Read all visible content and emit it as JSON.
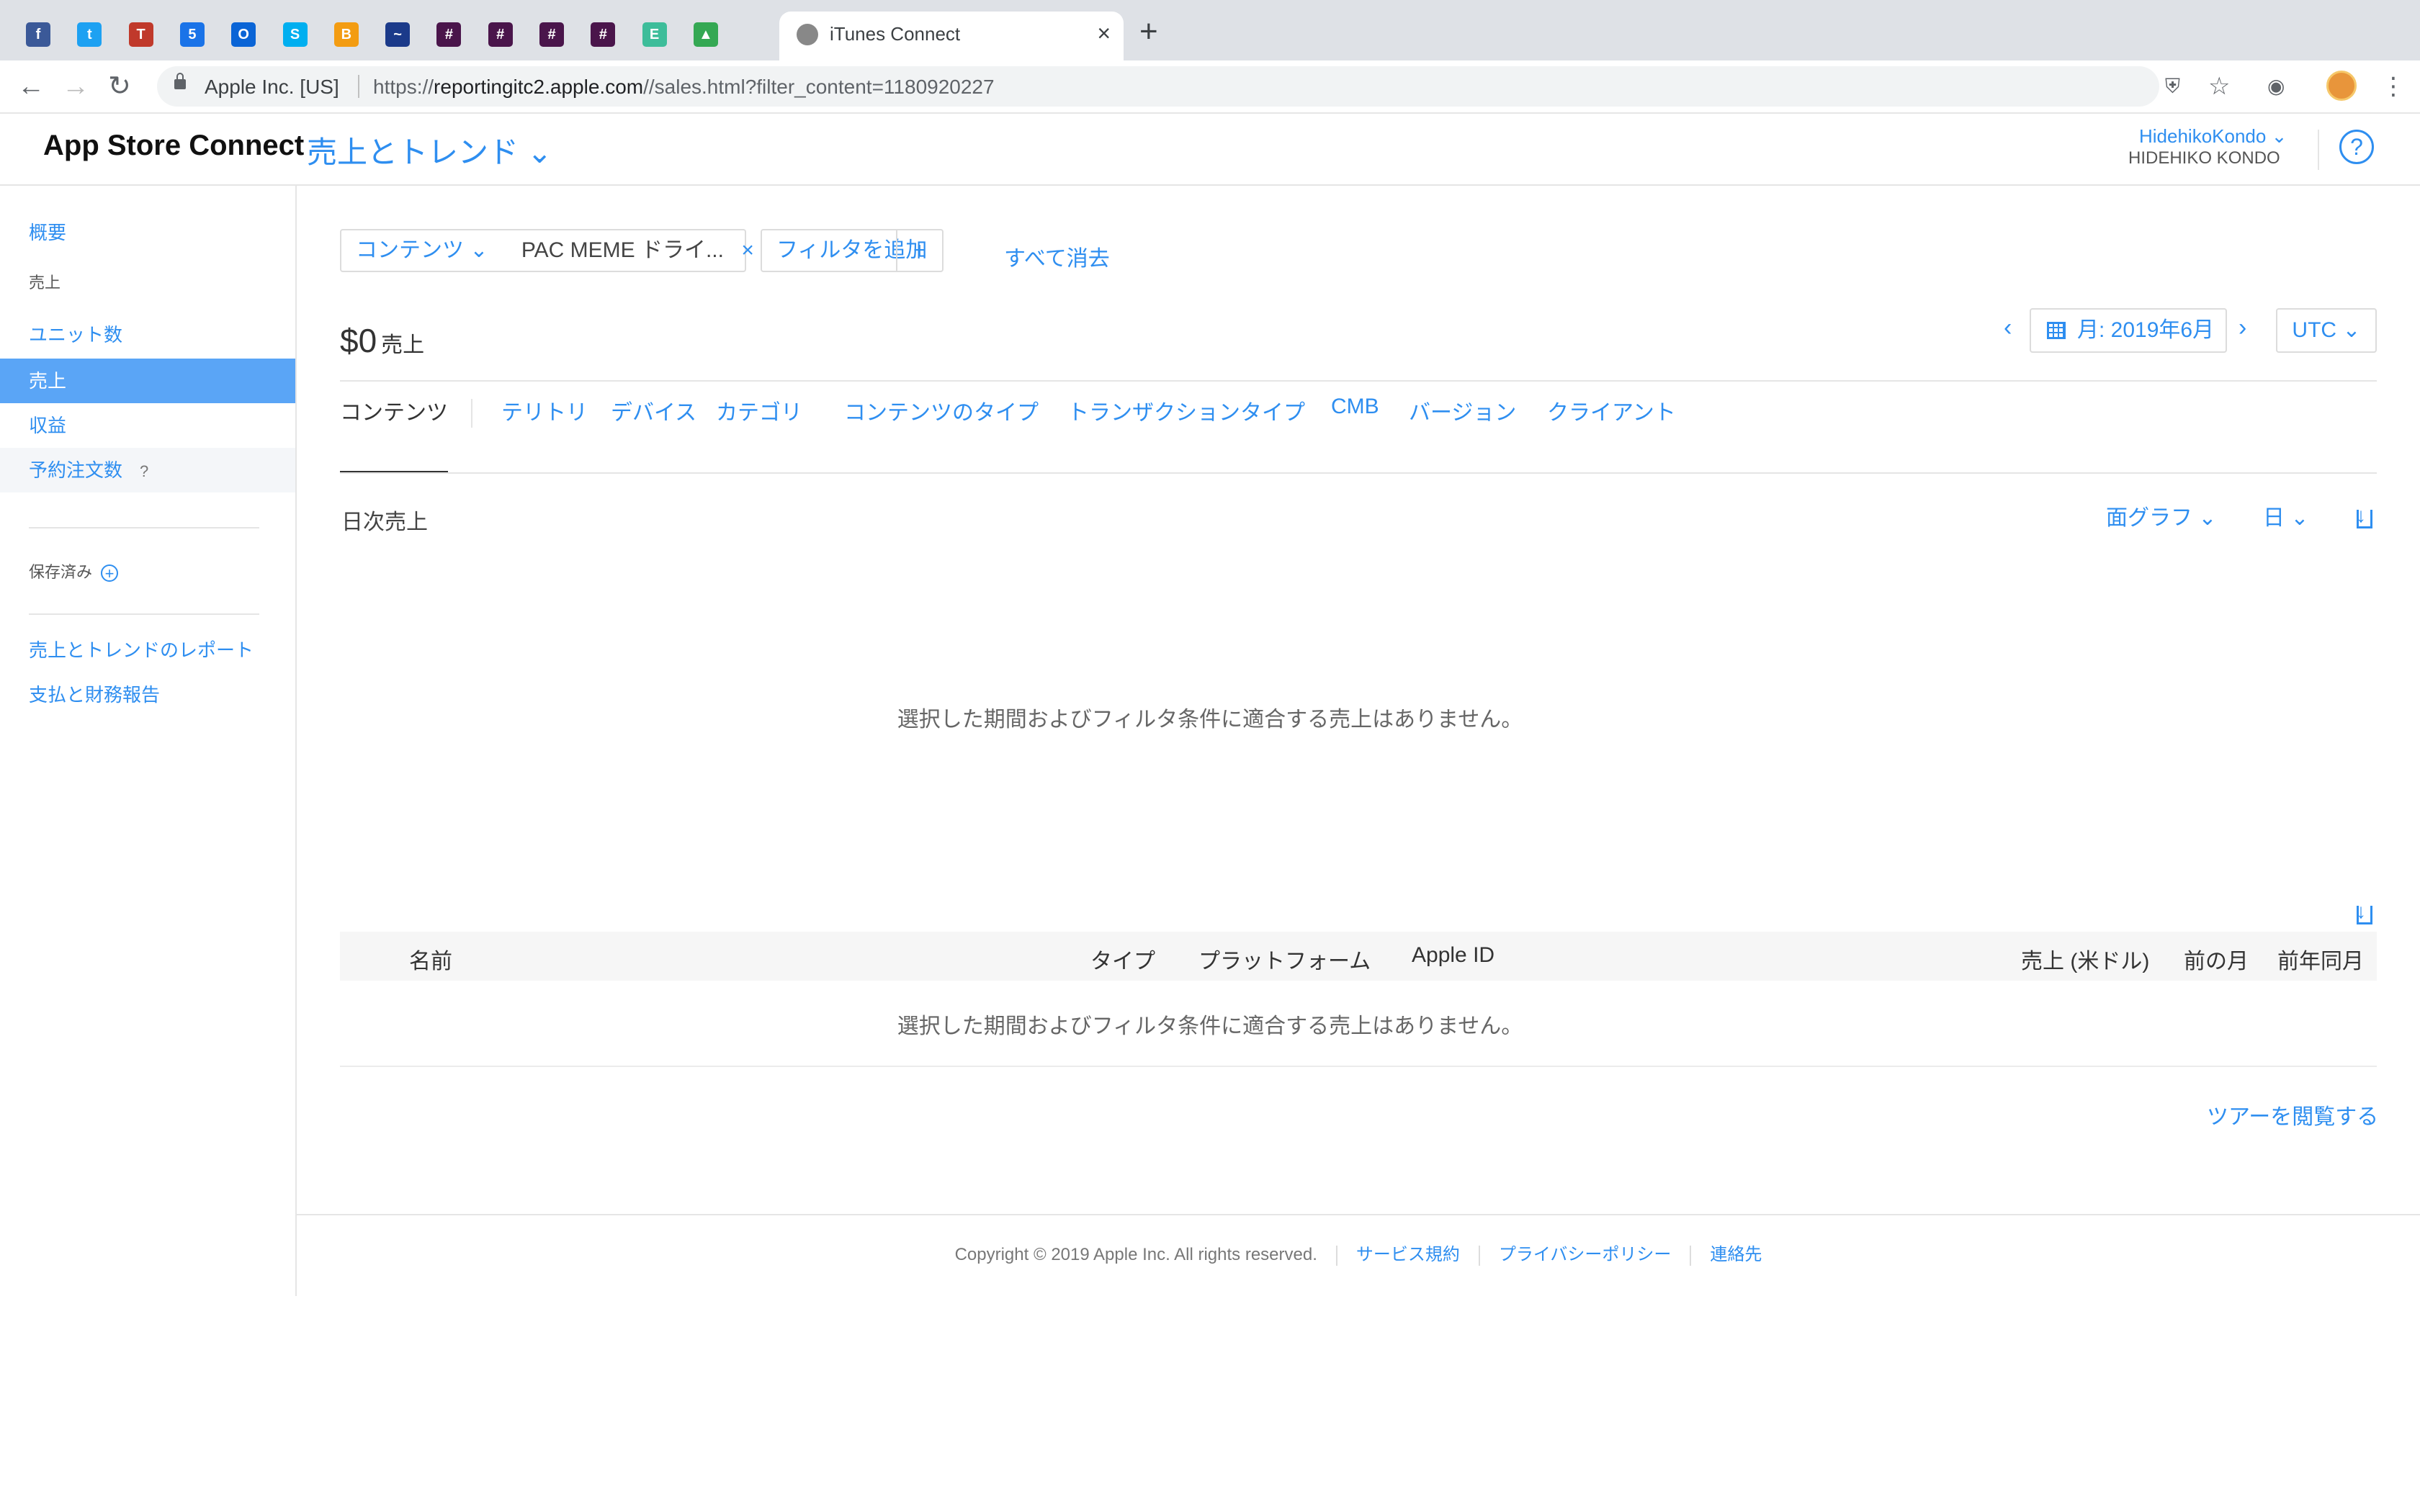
{
  "browser": {
    "pinned_tabs": [
      {
        "icon": "facebook-icon",
        "color": "#3b5998",
        "glyph": "f"
      },
      {
        "icon": "twitter-icon",
        "color": "#1da1f2",
        "glyph": "t"
      },
      {
        "icon": "trello-icon",
        "color": "#c0392b",
        "glyph": "T"
      },
      {
        "icon": "calendar-icon",
        "color": "#1a73e8",
        "glyph": "5"
      },
      {
        "icon": "outlook-icon",
        "color": "#0a64d6",
        "glyph": "O"
      },
      {
        "icon": "skype-icon",
        "color": "#00aff0",
        "glyph": "S"
      },
      {
        "icon": "backlog-icon",
        "color": "#f39c12",
        "glyph": "B"
      },
      {
        "icon": "chart-icon",
        "color": "#1b3a8a",
        "glyph": "~"
      },
      {
        "icon": "slack-icon",
        "color": "#4a154b",
        "glyph": "#"
      },
      {
        "icon": "slack-icon",
        "color": "#4a154b",
        "glyph": "#"
      },
      {
        "icon": "slack-icon",
        "color": "#4a154b",
        "glyph": "#"
      },
      {
        "icon": "slack-icon",
        "color": "#4a154b",
        "glyph": "#"
      },
      {
        "icon": "evernote-icon",
        "color": "#3dbd9a",
        "glyph": "E"
      },
      {
        "icon": "google-drive-icon",
        "color": "#34a853",
        "glyph": "▲"
      }
    ],
    "active_tab": {
      "title": "iTunes Connect"
    },
    "url": {
      "org": "Apple Inc. [US]",
      "prefix": "https://",
      "host": "reportingitc2.apple.com",
      "path": "//sales.html?filter_content=1180920227"
    }
  },
  "header": {
    "brand": "App Store Connect",
    "section": "売上とトレンド ⌄",
    "user_name": "HidehikoKondo ⌄",
    "user_sub": "HIDEHIKO KONDO",
    "help": "?"
  },
  "sidebar": {
    "overview": "概要",
    "sales_heading": "売上",
    "units": "ユニット数",
    "sales": "売上",
    "proceeds": "収益",
    "preorders": "予約注文数",
    "preorders_hint": "?",
    "saved": "保存済み",
    "reports": "売上とトレンドのレポート",
    "payments": "支払と財務報告"
  },
  "filters": {
    "content_label": "コンテンツ ⌄",
    "content_value": "PAC MEME ドライ...",
    "remove": "×",
    "add_filter": "フィルタを追加",
    "add_plus": "+",
    "clear_all": "すべて消去"
  },
  "summary": {
    "total": "$0",
    "total_label": "売上"
  },
  "period": {
    "prev": "‹",
    "label": "月: 2019年6月",
    "next": "›",
    "timezone": "UTC ⌄"
  },
  "tabs": [
    "コンテンツ",
    "テリトリ",
    "デバイス",
    "カテゴリ",
    "コンテンツのタイプ",
    "トランザクションタイプ",
    "CMB",
    "バージョン",
    "クライアント"
  ],
  "chart": {
    "title": "日次売上",
    "type_select": "面グラフ ⌄",
    "interval_select": "日 ⌄",
    "empty": "選択した期間およびフィルタ条件に適合する売上はありません。"
  },
  "table": {
    "headers": {
      "name": "名前",
      "type": "タイプ",
      "platform": "プラットフォーム",
      "apple_id": "Apple ID",
      "sales_usd": "売上 (米ドル)",
      "prev_month": "前の月",
      "prev_year": "前年同月"
    },
    "empty": "選択した期間およびフィルタ条件に適合する売上はありません。"
  },
  "tour_link": "ツアーを閲覧する",
  "footer": {
    "copyright": "Copyright © 2019 Apple Inc. All rights reserved.",
    "terms": "サービス規約",
    "privacy": "プライバシーポリシー",
    "contact": "連絡先"
  }
}
